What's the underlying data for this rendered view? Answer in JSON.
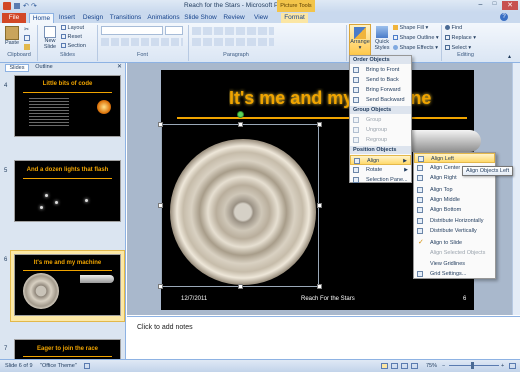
{
  "window": {
    "title": "Reach for the Stars - Microsoft PowerPoint",
    "context_tab_group": "Picture Tools"
  },
  "tabs": [
    "File",
    "Home",
    "Insert",
    "Design",
    "Transitions",
    "Animations",
    "Slide Show",
    "Review",
    "View",
    "Format"
  ],
  "ribbon": {
    "paste": "Paste",
    "new_slide": "New Slide",
    "layout": "Layout",
    "reset": "Reset",
    "section": "Section",
    "arrange": "Arrange",
    "quick_styles": "Quick Styles",
    "shape_fill": "Shape Fill",
    "shape_outline": "Shape Outline",
    "shape_effects": "Shape Effects",
    "find": "Find",
    "replace": "Replace",
    "select": "Select",
    "groups": {
      "clipboard": "Clipboard",
      "slides": "Slides",
      "font": "Font",
      "paragraph": "Paragraph",
      "editing": "Editing"
    }
  },
  "panel_tabs": [
    "Slides",
    "Outline"
  ],
  "thumbnails": [
    {
      "num": "4",
      "title": "Little bits of code"
    },
    {
      "num": "5",
      "title": "And a dozen lights that flash"
    },
    {
      "num": "6",
      "title": "It's me and my machine"
    },
    {
      "num": "7",
      "title": "Eager to join the race"
    }
  ],
  "slide": {
    "title": "It's me and my machine",
    "date": "12/7/2011",
    "footer": "Reach For the Stars",
    "page": "6"
  },
  "notes_placeholder": "Click to add notes",
  "arrange_menu": {
    "order_header": "Order Objects",
    "order": [
      "Bring to Front",
      "Send to Back",
      "Bring Forward",
      "Send Backward"
    ],
    "group_header": "Group Objects",
    "group": [
      "Group",
      "Ungroup",
      "Regroup"
    ],
    "position_header": "Position Objects",
    "position": [
      "Align",
      "Rotate",
      "Selection Pane..."
    ]
  },
  "align_menu": [
    "Align Left",
    "Align Center",
    "Align Right",
    "Align Top",
    "Align Middle",
    "Align Bottom",
    "Distribute Horizontally",
    "Distribute Vertically",
    "Align to Slide",
    "Align Selected Objects",
    "View Gridlines",
    "Grid Settings..."
  ],
  "tooltip": "Align Objects Left",
  "status": {
    "slide": "Slide 6 of 9",
    "theme": "\"Office Theme\"",
    "zoom": "75%"
  },
  "colors": {
    "accent": "#f0a400",
    "ribbon_blue": "#c9d9ee",
    "highlight": "#ffd96b"
  }
}
